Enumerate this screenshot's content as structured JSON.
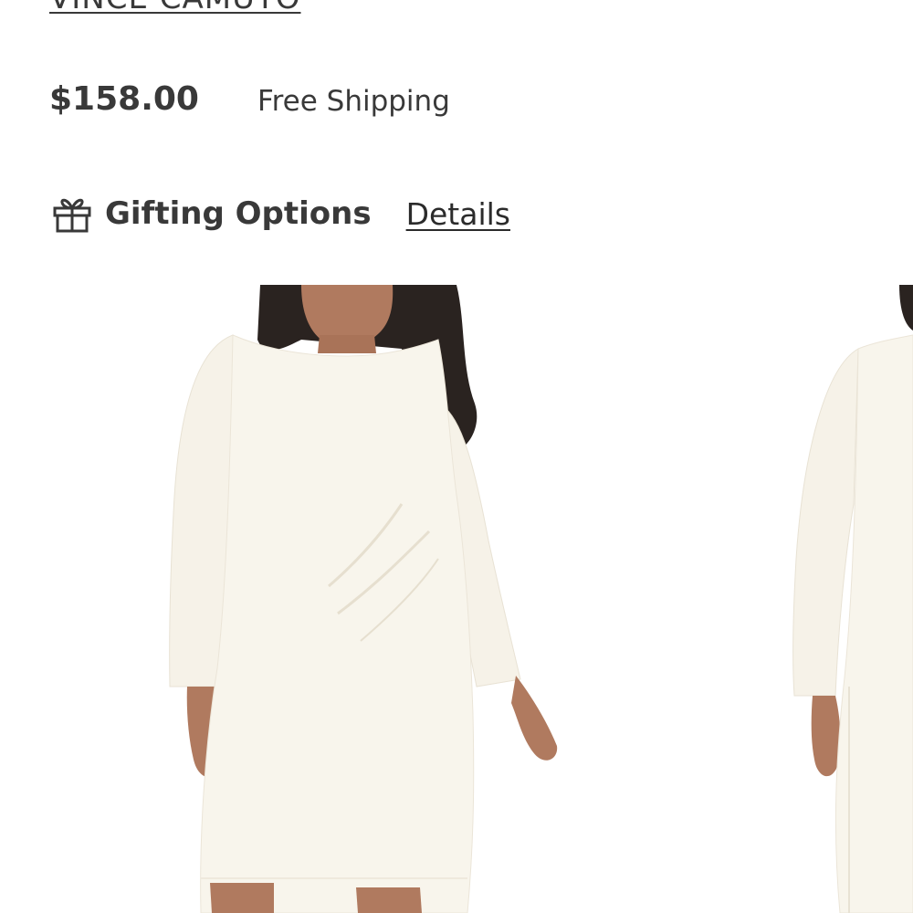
{
  "product": {
    "brand": "VINCE CAMUTO",
    "price": "$158.00",
    "shipping": "Free Shipping"
  },
  "gifting": {
    "icon": "gift-icon",
    "label": "Gifting Options",
    "details_link": "Details"
  },
  "gallery": {
    "images": [
      {
        "alt": "model-front-view"
      },
      {
        "alt": "model-side-view"
      }
    ]
  }
}
